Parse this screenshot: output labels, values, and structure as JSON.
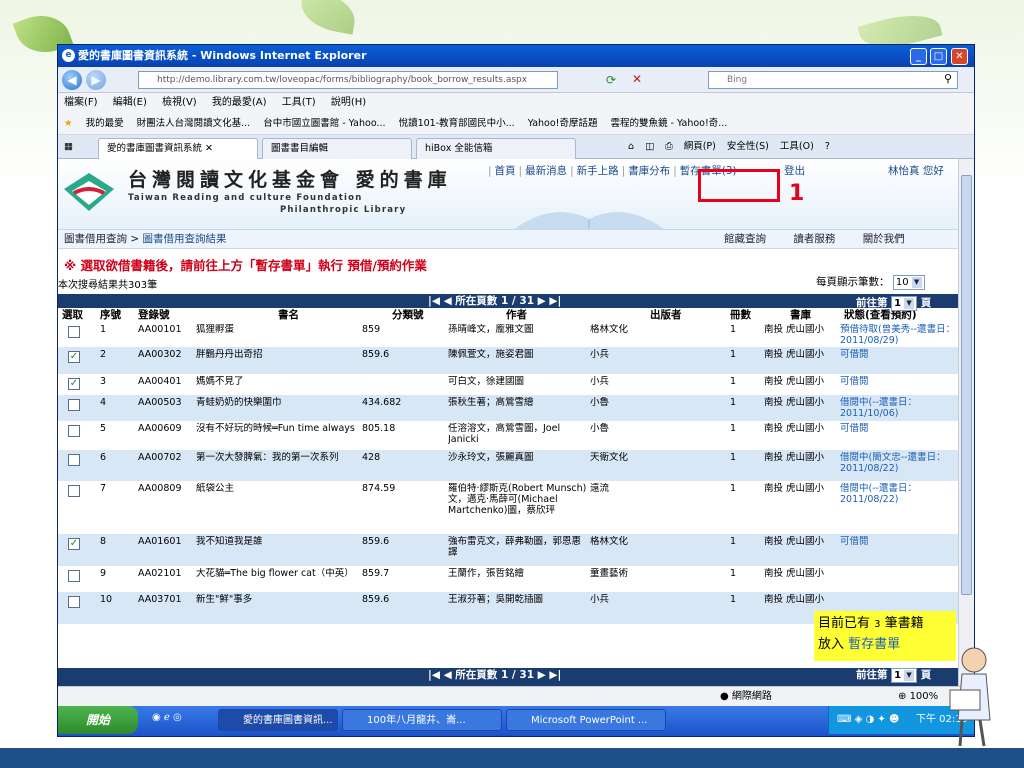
{
  "window": {
    "title": "愛的書庫圖書資訊系統 - Windows Internet Explorer",
    "url": "http://demo.library.com.tw/loveopac/forms/bibliography/book_borrow_results.aspx",
    "search_engine": "Bing"
  },
  "menu": [
    "檔案(F)",
    "編輯(E)",
    "檢視(V)",
    "我的最愛(A)",
    "工具(T)",
    "說明(H)"
  ],
  "favorites": [
    "我的最愛",
    "財團法人台灣閱讀文化基...",
    "台中市國立圖書館 - Yahoo...",
    "悅讀101-教育部國民中小...",
    "Yahoo!奇摩話題",
    "雲程的雙魚鏡 - Yahoo!奇..."
  ],
  "tabs": [
    {
      "label": "愛的書庫圖書資訊系統",
      "active": true
    },
    {
      "label": "圖書書目編輯",
      "active": false
    },
    {
      "label": "hiBox 全能信箱",
      "active": false
    }
  ],
  "commands": [
    "網頁(P)",
    "安全性(S)",
    "工具(O)"
  ],
  "site": {
    "title_cn": "台灣閱讀文化基金會 愛的書庫",
    "title_en1": "Taiwan Reading and culture Foundation",
    "title_en2": "Philanthropic Library",
    "topnav": [
      "首頁",
      "最新消息",
      "新手上路",
      "書庫分布",
      "暫存書單(3)"
    ],
    "logout": "登出",
    "user": "林怡真 您好",
    "annotation_number": "1"
  },
  "breadcrumb": {
    "root": "圖書借用查詢",
    "separator": ">",
    "current": "圖書借用查詢結果"
  },
  "rightnav": [
    "館藏查詢",
    "讀者服務",
    "關於我們"
  ],
  "notice": "※ 選取欲借書籍後，請前往上方「暫存書單」執行 預借/預約作業",
  "result_count": "本次搜尋結果共303筆",
  "per_page": {
    "label": "每頁顯示筆數：",
    "value": "10"
  },
  "pager": {
    "text": "|◀ ◀ 所在頁數 1 / 31 ▶ ▶|",
    "goto_label": "前往第",
    "page_value": "1",
    "page_unit": "頁"
  },
  "columns": [
    "選取",
    "序號",
    "登錄號",
    "書名",
    "分類號",
    "作者",
    "出版者",
    "冊數",
    "書庫",
    "狀態(查看預約)"
  ],
  "rows": [
    {
      "checked": false,
      "no": "1",
      "reg": "AA00101",
      "title": "狐狸孵蛋",
      "class": "859",
      "author": "孫晴峰文，龐雅文圖",
      "publisher": "格林文化",
      "qty": "1",
      "lib": "南投 虎山國小",
      "status": "預借待取(曾美秀--還書日：2011/08/29)"
    },
    {
      "checked": true,
      "no": "2",
      "reg": "AA00302",
      "title": "胖鶴丹丹出奇招",
      "class": "859.6",
      "author": "陳佩萱文，施姿君圖",
      "publisher": "小兵",
      "qty": "1",
      "lib": "南投 虎山國小",
      "status": "可借閱"
    },
    {
      "checked": true,
      "no": "3",
      "reg": "AA00401",
      "title": "媽媽不見了",
      "class": "",
      "author": "可白文，徐建國圖",
      "publisher": "小兵",
      "qty": "1",
      "lib": "南投 虎山國小",
      "status": "可借閱"
    },
    {
      "checked": false,
      "no": "4",
      "reg": "AA00503",
      "title": "青蛙奶奶的快樂圍巾",
      "class": "434.682",
      "author": "張秋生著；高鶯雪繪",
      "publisher": "小魯",
      "qty": "1",
      "lib": "南投 虎山國小",
      "status": "借閱中(--還書日：2011/10/06)"
    },
    {
      "checked": false,
      "no": "5",
      "reg": "AA00609",
      "title": "沒有不好玩的時候═Fun time always",
      "class": "805.18",
      "author": "任溶溶文，高鶯雪圖，Joel Janicki",
      "publisher": "小魯",
      "qty": "1",
      "lib": "南投 虎山國小",
      "status": "可借閱"
    },
    {
      "checked": false,
      "no": "6",
      "reg": "AA00702",
      "title": "第一次大發脾氣：我的第一次系列",
      "class": "428",
      "author": "沙永玲文，張麗真圖",
      "publisher": "天衛文化",
      "qty": "1",
      "lib": "南投 虎山國小",
      "status": "借閱中(簡文忠--還書日：2011/08/22)"
    },
    {
      "checked": false,
      "no": "7",
      "reg": "AA00809",
      "title": "紙袋公主",
      "class": "874.59",
      "author": "羅伯特·繆斯克(Robert Munsch)文，邁克·馬薛可(Michael Martchenko)圖，蔡欣玶",
      "publisher": "遠流",
      "qty": "1",
      "lib": "南投 虎山國小",
      "status": "借閱中(--還書日：2011/08/22)"
    },
    {
      "checked": true,
      "no": "8",
      "reg": "AA01601",
      "title": "我不知道我是誰",
      "class": "859.6",
      "author": "強布雷克文，薛弗勒圖，郭恩惠譯",
      "publisher": "格林文化",
      "qty": "1",
      "lib": "南投 虎山國小",
      "status": "可借閱"
    },
    {
      "checked": false,
      "no": "9",
      "reg": "AA02101",
      "title": "大花貓═The big flower cat（中英）",
      "class": "859.7",
      "author": "王蘭作，張哲銘繪",
      "publisher": "童畫藝術",
      "qty": "1",
      "lib": "南投 虎山國小",
      "status": ""
    },
    {
      "checked": false,
      "no": "10",
      "reg": "AA03701",
      "title": "新生\"鮮\"事多",
      "class": "859.6",
      "author": "王淑芬著；吳開乾插圖",
      "publisher": "小兵",
      "qty": "1",
      "lib": "南投 虎山國小",
      "status": ""
    }
  ],
  "tooltip": {
    "line1_prefix": "目前已有",
    "count": "3",
    "line1_suffix": "筆書籍",
    "line2_prefix": "放入",
    "line2_link": "暫存書單"
  },
  "statusbar": {
    "network": "網際網路",
    "zoom": "100%"
  },
  "taskbar": {
    "start": "開始",
    "tasks": [
      "愛的書庫圖書資訊...",
      "100年八月龍井、崙...",
      "Microsoft PowerPoint ..."
    ],
    "clock": "下午 02:19"
  }
}
